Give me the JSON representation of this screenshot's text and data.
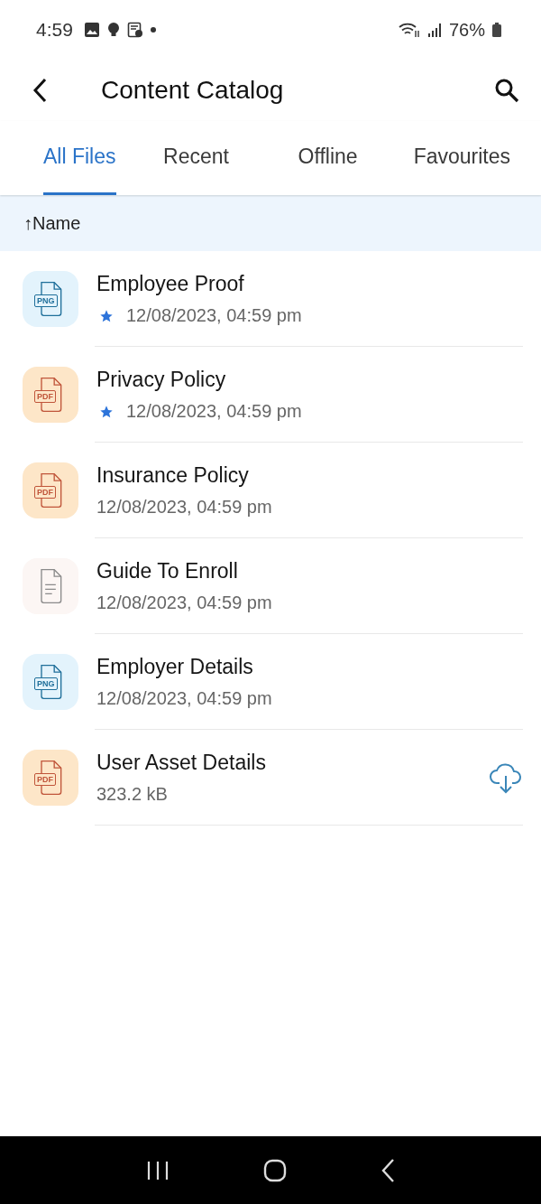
{
  "status_bar": {
    "time": "4:59",
    "battery": "76%"
  },
  "app_bar": {
    "title": "Content Catalog"
  },
  "tabs": [
    {
      "label": "All Files",
      "selected": true
    },
    {
      "label": "Recent",
      "selected": false
    },
    {
      "label": "Offline",
      "selected": false
    },
    {
      "label": "Favourites",
      "selected": false
    }
  ],
  "sort": {
    "arrow": "↑",
    "label": "Name"
  },
  "files": [
    {
      "kind": "png",
      "badge": "PNG",
      "name": "Employee Proof",
      "starred": true,
      "meta": "12/08/2023, 04:59 pm",
      "downloadable": false
    },
    {
      "kind": "pdf",
      "badge": "PDF",
      "name": "Privacy Policy",
      "starred": true,
      "meta": "12/08/2023, 04:59 pm",
      "downloadable": false
    },
    {
      "kind": "pdf",
      "badge": "PDF",
      "name": "Insurance Policy",
      "starred": false,
      "meta": "12/08/2023, 04:59 pm",
      "downloadable": false
    },
    {
      "kind": "doc",
      "name": "Guide To Enroll",
      "starred": false,
      "meta": "12/08/2023, 04:59 pm",
      "downloadable": false
    },
    {
      "kind": "png",
      "badge": "PNG",
      "name": "Employer Details",
      "starred": false,
      "meta": "12/08/2023, 04:59 pm",
      "downloadable": false
    },
    {
      "kind": "pdf",
      "badge": "PDF",
      "name": "User Asset Details",
      "starred": false,
      "meta": "323.2 kB",
      "downloadable": true
    }
  ]
}
